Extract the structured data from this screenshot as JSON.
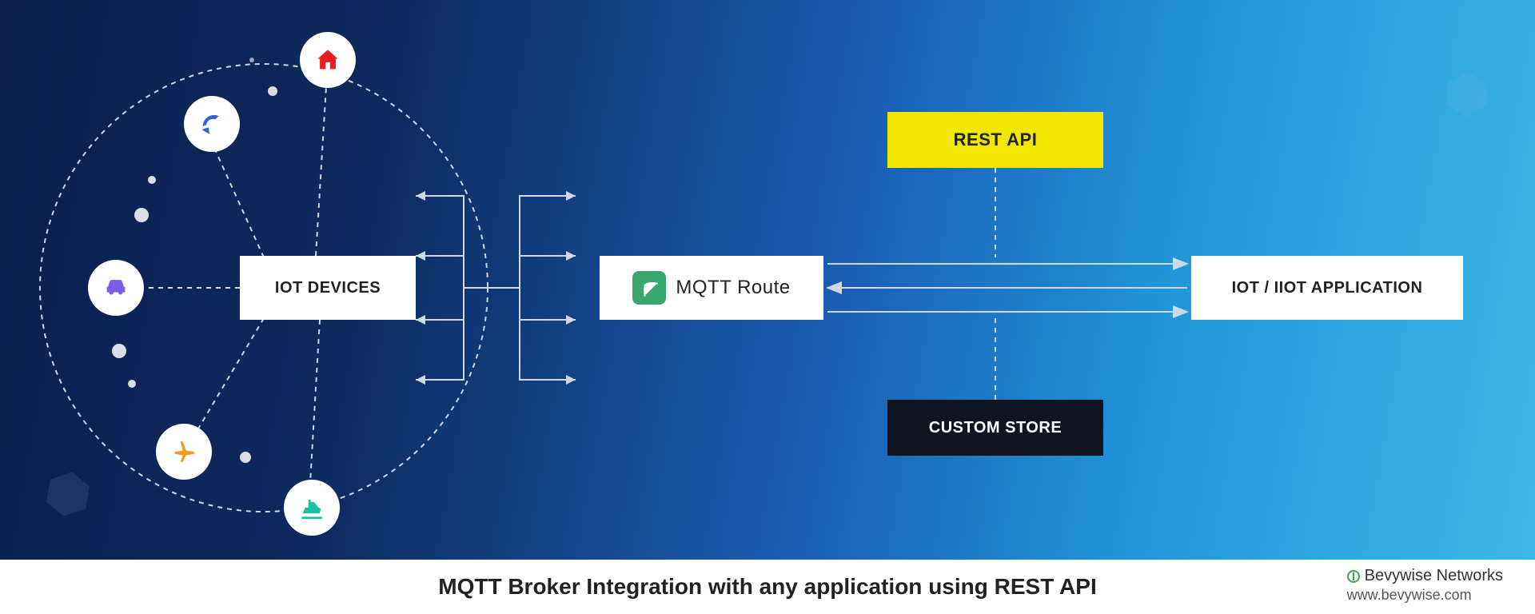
{
  "boxes": {
    "iot_devices": "IOT DEVICES",
    "mqtt_route": "MQTT Route",
    "rest_api": "REST API",
    "custom_store": "CUSTOM STORE",
    "iot_app": "IOT / IIOT APPLICATION"
  },
  "devices": [
    {
      "id": "home",
      "color": "#e62020"
    },
    {
      "id": "satellite",
      "color": "#2f64d6"
    },
    {
      "id": "car",
      "color": "#7a5de8"
    },
    {
      "id": "plane",
      "color": "#f59a1b"
    },
    {
      "id": "ship",
      "color": "#1abfa4"
    }
  ],
  "footer": {
    "title": "MQTT Broker Integration with any application using REST API",
    "brand_name": "Bevywise Networks",
    "brand_url": "www.bevywise.com"
  },
  "colors": {
    "bg_left": "#0a1f4d",
    "bg_right": "#3db8e8",
    "yellow": "#f0e600",
    "dark": "#0e1521",
    "mqtt_green": "#3aa76d"
  }
}
